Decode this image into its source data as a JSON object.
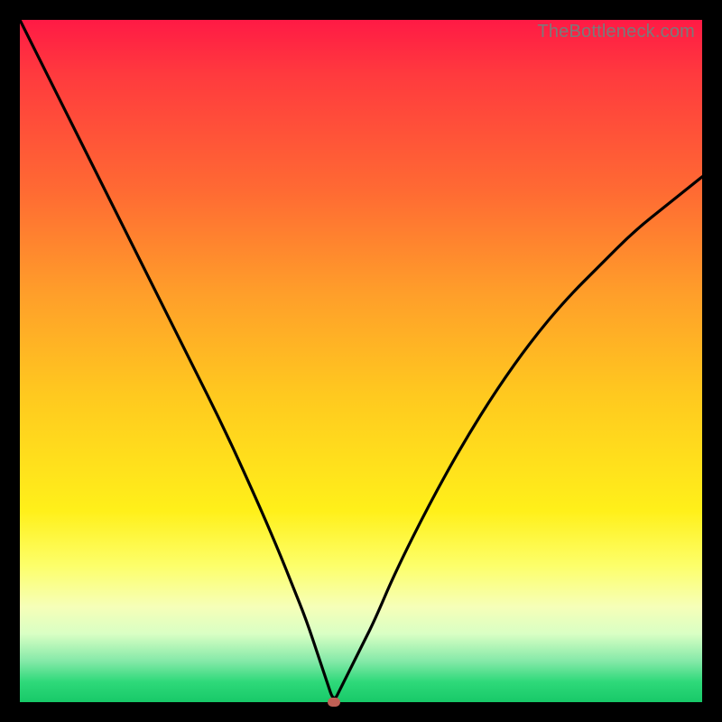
{
  "watermark": "TheBottleneck.com",
  "colors": {
    "frame": "#000000",
    "curve": "#000000",
    "dot": "#c06055",
    "gradient_stops": [
      "#ff1a45",
      "#ff6a33",
      "#ffc91f",
      "#fff01a",
      "#f6ffb8",
      "#2fd97a",
      "#17c968"
    ]
  },
  "chart_data": {
    "type": "line",
    "title": "",
    "xlabel": "",
    "ylabel": "",
    "xlim": [
      0,
      100
    ],
    "ylim": [
      0,
      100
    ],
    "annotations": [
      {
        "name": "min-point",
        "x": 46,
        "y": 0
      }
    ],
    "series": [
      {
        "name": "bottleneck-curve",
        "x": [
          0,
          5,
          10,
          15,
          20,
          25,
          30,
          35,
          38,
          40,
          42,
          44,
          45,
          46,
          47,
          48,
          50,
          52,
          55,
          60,
          65,
          70,
          75,
          80,
          85,
          90,
          95,
          100
        ],
        "y": [
          100,
          90,
          80,
          70,
          60,
          50,
          40,
          29,
          22,
          17,
          12,
          6,
          3,
          0,
          2,
          4,
          8,
          12,
          19,
          29,
          38,
          46,
          53,
          59,
          64,
          69,
          73,
          77
        ]
      }
    ]
  }
}
